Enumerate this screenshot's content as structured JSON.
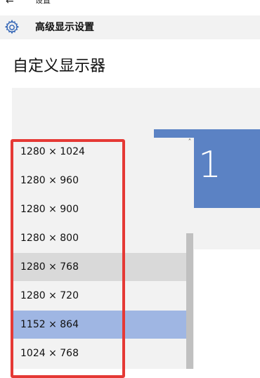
{
  "topbar": {
    "back_icon": "arrow-left-icon",
    "label": "设置"
  },
  "header": {
    "icon": "gear-icon",
    "title": "高级显示设置"
  },
  "page": {
    "title": "自定义显示器"
  },
  "monitor": {
    "number": "1",
    "color": "#5b82c4"
  },
  "resolution_list": {
    "options": [
      "1280 × 1024",
      "1280 × 960",
      "1280 × 900",
      "1280 × 800",
      "1280 × 768",
      "1280 × 720",
      "1152 × 864",
      "1024 × 768"
    ],
    "hovered": "1280 × 768",
    "selected": "1152 × 864",
    "selected_color": "#9fb6e3",
    "hover_color": "#d9d9d9"
  },
  "annotation": {
    "color": "#e53935"
  }
}
